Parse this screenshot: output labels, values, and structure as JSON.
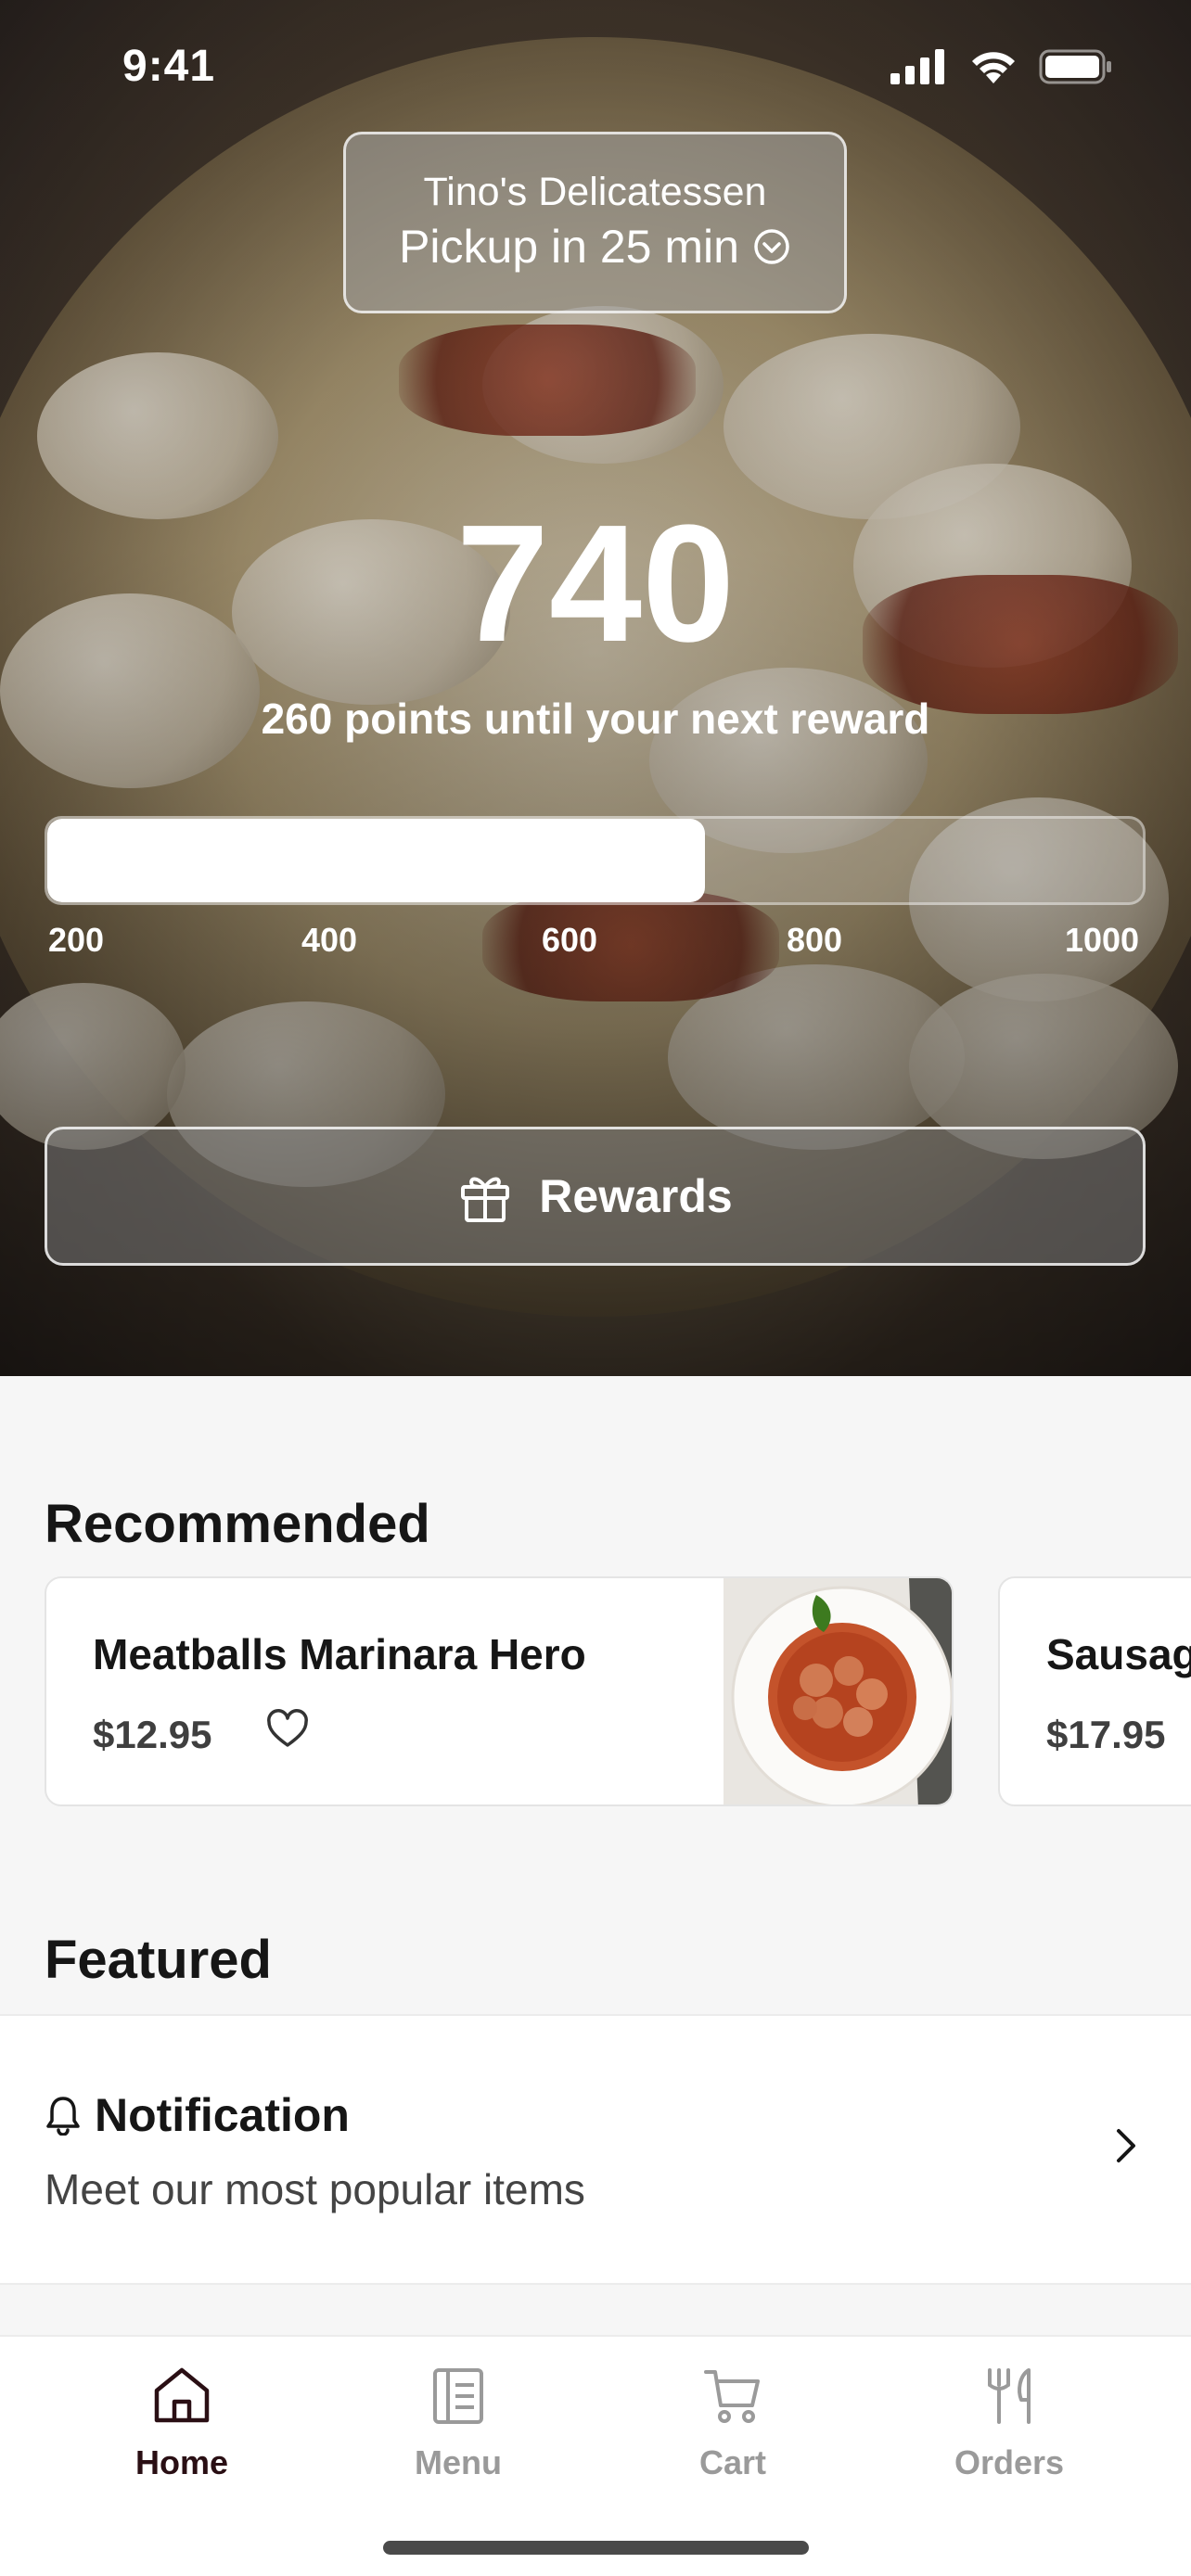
{
  "status_bar": {
    "time": "9:41"
  },
  "store": {
    "name": "Tino's Delicatessen",
    "pickup": "Pickup in 25 min"
  },
  "rewards": {
    "points": "740",
    "subtitle": "260 points until your next reward",
    "progress_fraction": 0.6,
    "ticks": [
      "200",
      "400",
      "600",
      "800",
      "1000"
    ],
    "button_label": "Rewards"
  },
  "recommended": {
    "title": "Recommended",
    "items": [
      {
        "name": "Meatballs Marinara  Hero",
        "price": "$12.95"
      },
      {
        "name": "Sausag",
        "price": "$17.95"
      }
    ]
  },
  "featured": {
    "title": "Featured",
    "notification_title": "Notification",
    "notification_text": "Meet our most popular items"
  },
  "tabs": [
    {
      "label": "Home",
      "active": true
    },
    {
      "label": "Menu",
      "active": false
    },
    {
      "label": "Cart",
      "active": false
    },
    {
      "label": "Orders",
      "active": false
    }
  ],
  "colors": {
    "accent_dark": "#2a0f14",
    "inactive": "#9a9a9a"
  }
}
